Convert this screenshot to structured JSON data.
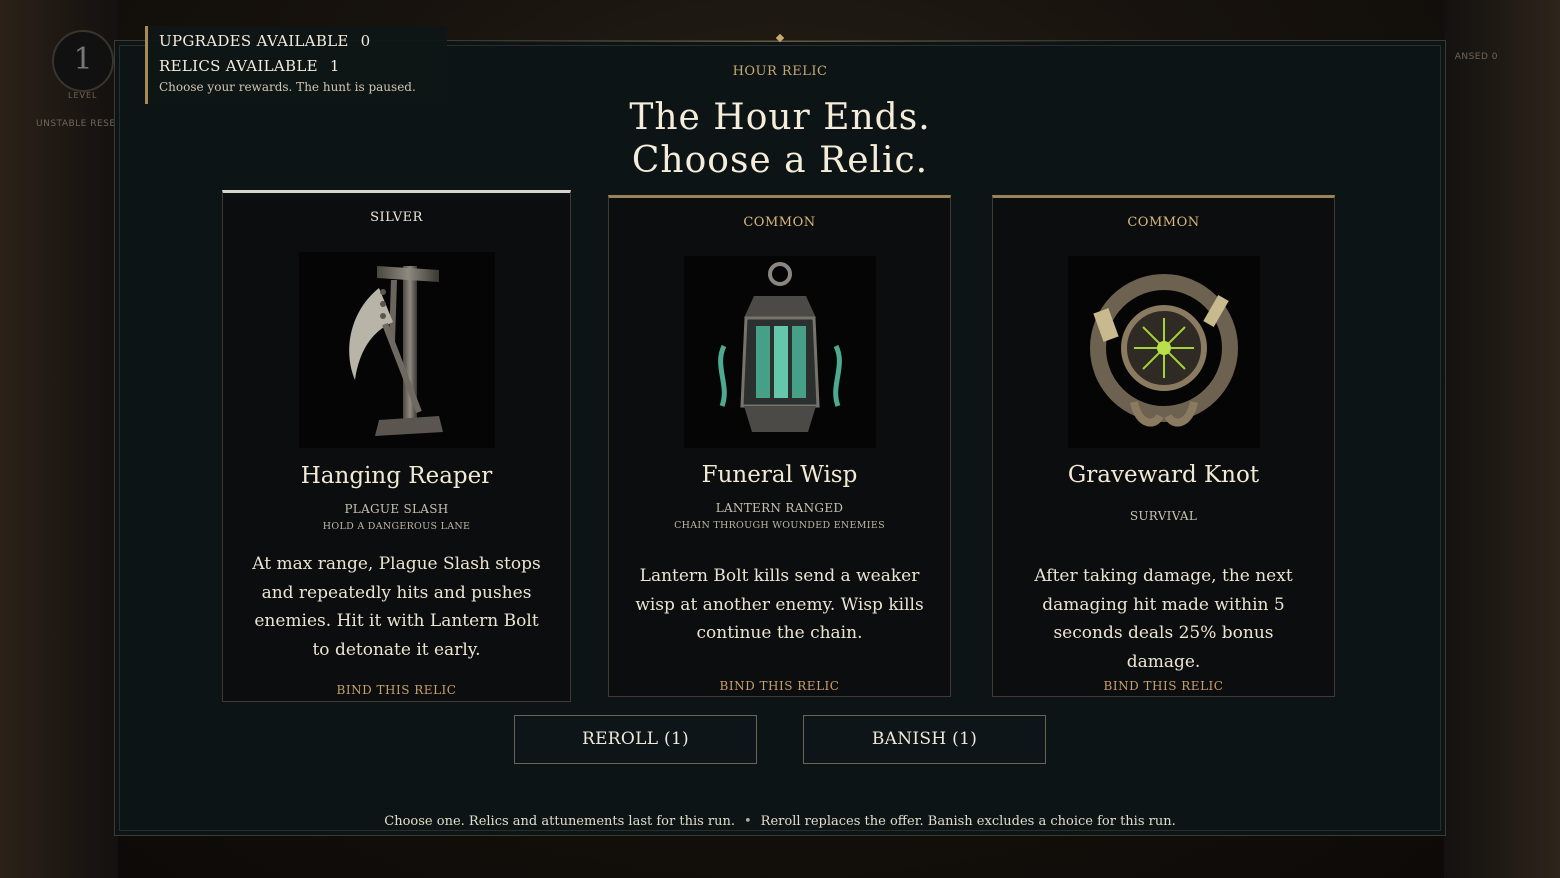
{
  "hud": {
    "upgrades_label": "UPGRADES AVAILABLE",
    "upgrades_value": "0",
    "relics_label": "RELICS AVAILABLE",
    "relics_value": "1",
    "note": "Choose your rewards. The hunt is paused.",
    "level_value": "1",
    "level_label": "LEVEL",
    "unstable_label": "UNSTABLE RESE",
    "right_label": "ANSED 0"
  },
  "header": {
    "kicker": "HOUR RELIC",
    "title_line1": "The Hour Ends.",
    "title_line2": "Choose a Relic."
  },
  "cards": [
    {
      "rarity": "SILVER",
      "name": "Hanging Reaper",
      "tag1": "PLAGUE SLASH",
      "tag2": "HOLD A DANGEROUS LANE",
      "description": "At max range, Plague Slash stops and repeatedly hits and pushes enemies. Hit it with Lantern Bolt to detonate it early.",
      "bind_label": "BIND THIS RELIC",
      "icon": "gallows-scythe-icon"
    },
    {
      "rarity": "COMMON",
      "name": "Funeral Wisp",
      "tag1": "LANTERN RANGED",
      "tag2": "CHAIN THROUGH WOUNDED ENEMIES",
      "description": "Lantern Bolt kills send a weaker wisp at another enemy. Wisp kills continue the chain.",
      "bind_label": "BIND THIS RELIC",
      "icon": "lantern-wisp-icon"
    },
    {
      "rarity": "COMMON",
      "name": "Graveward Knot",
      "tag1": "SURVIVAL",
      "tag2": "",
      "description": "After taking damage, the next damaging hit made within 5 seconds deals 25% bonus damage.",
      "bind_label": "BIND THIS RELIC",
      "icon": "bone-knot-icon"
    }
  ],
  "buttons": {
    "reroll": "REROLL (1)",
    "banish": "BANISH (1)"
  },
  "footer": {
    "part1": "Choose one. Relics and attunements last for this run.",
    "separator": "•",
    "part2": "Reroll replaces the offer. Banish excludes a choice for this run."
  },
  "colors": {
    "accent_gold": "#c8a06a",
    "panel_bg": "#0d1416",
    "card_bg": "#0c0d0e",
    "silver_border": "#d8d3c8",
    "common_border": "#9a8456"
  }
}
